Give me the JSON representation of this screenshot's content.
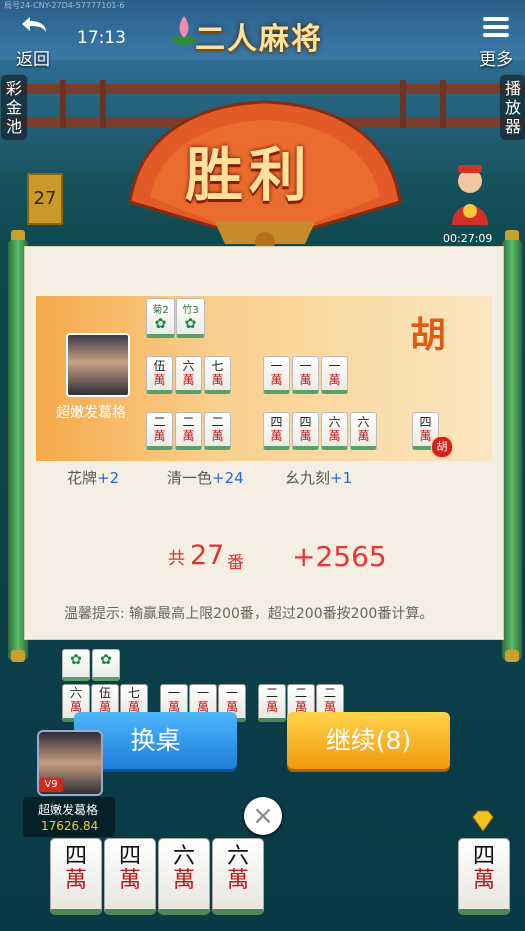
{
  "header": {
    "serial": "局号24-CNY-27D4-57777101-6",
    "back_label": "返回",
    "time": "17:13",
    "title": "二人麻将",
    "more_label": "更多"
  },
  "side": {
    "jackpot_label": "彩金池",
    "player_label": "播放器",
    "round_counter": "27"
  },
  "result": {
    "title": "胜利",
    "timer": "00:27:09",
    "player_name": "超嫩发葛格",
    "hu_char": "胡",
    "hu_badge": "胡",
    "flowers": [
      {
        "num": "2",
        "name": "菊"
      },
      {
        "num": "3",
        "name": "竹"
      }
    ],
    "melds_row1": [
      [
        "伍",
        "六",
        "七"
      ],
      [
        "一",
        "一",
        "一"
      ]
    ],
    "melds_row2": [
      [
        "二",
        "二",
        "二"
      ],
      [
        "四",
        "四",
        "六",
        "六"
      ]
    ],
    "winning_tile": "四",
    "wan": "萬",
    "fan_items": [
      {
        "name": "花牌",
        "points": "+2"
      },
      {
        "name": "清一色",
        "points": "+24"
      },
      {
        "name": "幺九刻",
        "points": "+1"
      }
    ],
    "total_prefix": "共",
    "total_fan": "27",
    "total_unit": "番",
    "score": "+2565",
    "tip": "温馨提示: 输赢最高上限200番，超过200番按200番计算。"
  },
  "table": {
    "melds": [
      [
        "六",
        "伍",
        "七"
      ],
      [
        "一",
        "一",
        "一"
      ],
      [
        "二",
        "二",
        "二"
      ]
    ],
    "switch_label": "换桌",
    "continue_label": "继续(8)",
    "me_name": "超嫩发葛格",
    "me_coins": "17626.84",
    "vip": "V9",
    "close": "×",
    "hand": [
      "四",
      "四",
      "六",
      "六"
    ],
    "drawn": "四"
  },
  "colors": {
    "accent_blue": "#1e7ed8",
    "accent_gold": "#f29a10",
    "win_red": "#d33"
  }
}
